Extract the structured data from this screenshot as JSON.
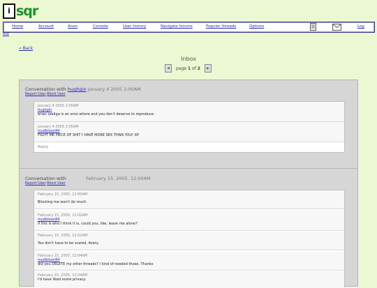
{
  "logo": {
    "box_text": "i",
    "text": "sqr"
  },
  "nav": {
    "home": "Home",
    "account": "Account",
    "anon": "Anon",
    "console": "Console",
    "user_history": "User history",
    "navigate_forums": "Navigate forums",
    "popular_threads": "Popular threads",
    "options": "Options",
    "logout_head": "Log",
    "logout_tail": "out",
    "icons": [
      "document-icon",
      "mail-icon"
    ]
  },
  "back_link": "« Back",
  "inbox": {
    "title": "Inbox",
    "page_label": "page",
    "page_current": "1",
    "page_of": "of",
    "page_total": "2",
    "prev": "◄",
    "next": "►"
  },
  "conversations": [
    {
      "title": "Conversation with",
      "partner": "hughgin",
      "date": "January 4 2005 2:00AM",
      "report_label": "Report User",
      "block_label": "Block User",
      "messages": [
        {
          "date": "January 4 2005 2:00AM",
          "author": "hughgin",
          "text": "brian szeliga is an emo whore and you don't deserve to reproduce."
        },
        {
          "date": "January 4 2005 2:05AM",
          "author": "mudbloon84",
          "text": "FIGHT ME PIECE OF SHIT I HAVE MORE SEX THAN YOU! XP"
        }
      ],
      "reply_label": "Reply"
    },
    {
      "title": "Conversation with",
      "partner": "",
      "date": "February 15, 2005, 12:00AM",
      "report_label": "Report User",
      "block_label": "Block User",
      "messages": [
        {
          "date": "February 15, 2005, 12:00AM",
          "author": "",
          "text": "Blocking me won't do much."
        },
        {
          "date": "February 15, 2005, 12:02AM",
          "author": "mudbloon84",
          "text": "if this is who I think it is, could you, like, leave me alone?"
        },
        {
          "date": "February 15, 2005, 12:02AM",
          "author": "",
          "text": "You don't have to be scared, Avery."
        },
        {
          "date": "February 15, 2005, 12:04AM",
          "author": "mudbloon84",
          "text": "did you DELETE my other threads? I kind of needed those. Thanks"
        },
        {
          "date": "February 15, 2005, 12:04AM",
          "author": "",
          "text": "I'd have liked some privacy."
        }
      ]
    }
  ]
}
